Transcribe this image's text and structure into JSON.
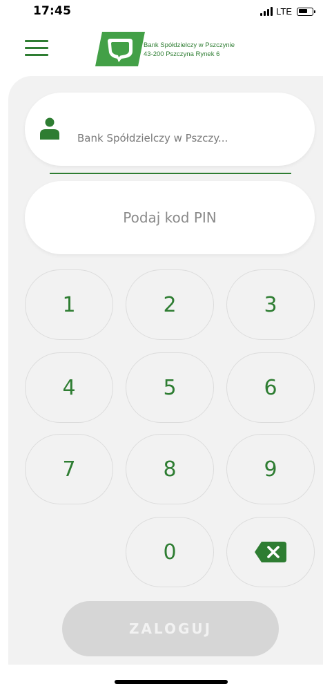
{
  "status_bar": {
    "time": "17:45",
    "network": "LTE",
    "icons": [
      "signal-icon",
      "battery-icon"
    ]
  },
  "header": {
    "menu_icon": "hamburger-menu-icon",
    "logo_line1": "Bank Spółdzielczy w Pszczynie",
    "logo_line2": "43-200 Pszczyna Rynek 6"
  },
  "bank_selector": {
    "icon": "user-icon",
    "value": "Bank Spółdzielczy w Pszczy..."
  },
  "pin_input": {
    "placeholder": "Podaj kod PIN"
  },
  "keypad": {
    "keys": [
      "1",
      "2",
      "3",
      "4",
      "5",
      "6",
      "7",
      "8",
      "9",
      "0"
    ],
    "delete_icon": "backspace-icon"
  },
  "login_button": {
    "label": "ZALOGUJ"
  },
  "colors": {
    "accent": "#2e7d32",
    "panel": "#f2f2f2",
    "disabled_button": "#d6d6d6"
  }
}
